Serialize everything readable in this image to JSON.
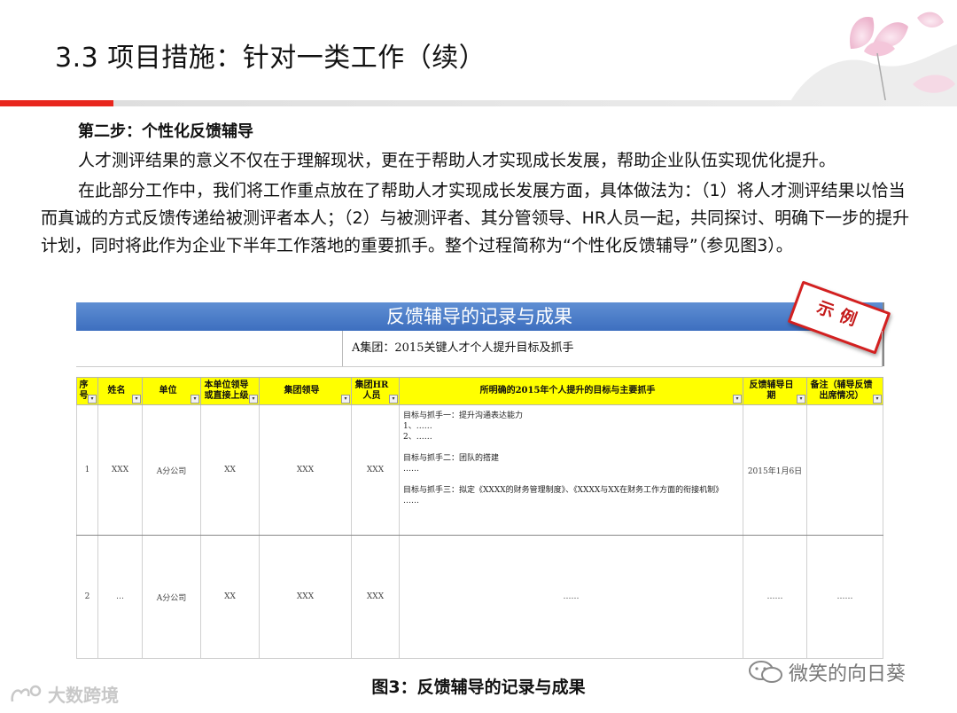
{
  "header": {
    "title": "3.3 项目措施：针对一类工作（续）"
  },
  "body": {
    "step_heading": "第二步：个性化反馈辅导",
    "para1": "人才测评结果的意义不仅在于理解现状，更在于帮助人才实现成长发展，帮助企业队伍实现优化提升。",
    "para2": "在此部分工作中，我们将工作重点放在了帮助人才实现成长发展方面，具体做法为：（1）将人才测评结果以恰当而真诚的方式反馈传递给被测评者本人；（2）与被测评者、其分管领导、HR人员一起，共同探讨、明确下一步的提升计划，同时将此作为企业下半年工作落地的重要抓手。整个过程简称为“个性化反馈辅导”（参见图3）。"
  },
  "figure": {
    "banner": "反馈辅导的记录与成果",
    "stamp": "示例",
    "subtitle": "A集团：2015关键人才个人提升目标及抓手",
    "columns": [
      "序号",
      "姓名",
      "单位",
      "本单位领导或直接上级",
      "集团领导",
      "集团HR人员",
      "所明确的2015年个人提升的目标与主要抓手",
      "反馈辅导日期",
      "备注（辅导反馈出席情况）"
    ],
    "rows": [
      {
        "no": "1",
        "name": "XXX",
        "unit": "A分公司",
        "leader": "XX",
        "group_leader": "XXX",
        "hr": "XXX",
        "goals": [
          "目标与抓手一：提升沟通表达能力",
          "1、……",
          "2、……",
          "",
          "目标与抓手二：团队的搭建",
          "……",
          "",
          "目标与抓手三：拟定《XXXX的财务管理制度》、《XXXX与XX在财务工作方面的衔接机制》",
          "……"
        ],
        "date": "2015年1月6日",
        "note": ""
      },
      {
        "no": "2",
        "name": "…",
        "unit": "A分公司",
        "leader": "XX",
        "group_leader": "XXX",
        "hr": "XXX",
        "goals_text": "……",
        "date": "……",
        "note": "……"
      }
    ],
    "caption": "图3：反馈辅导的记录与成果"
  },
  "watermarks": {
    "right": "微笑的向日葵",
    "left": "大数跨境"
  }
}
